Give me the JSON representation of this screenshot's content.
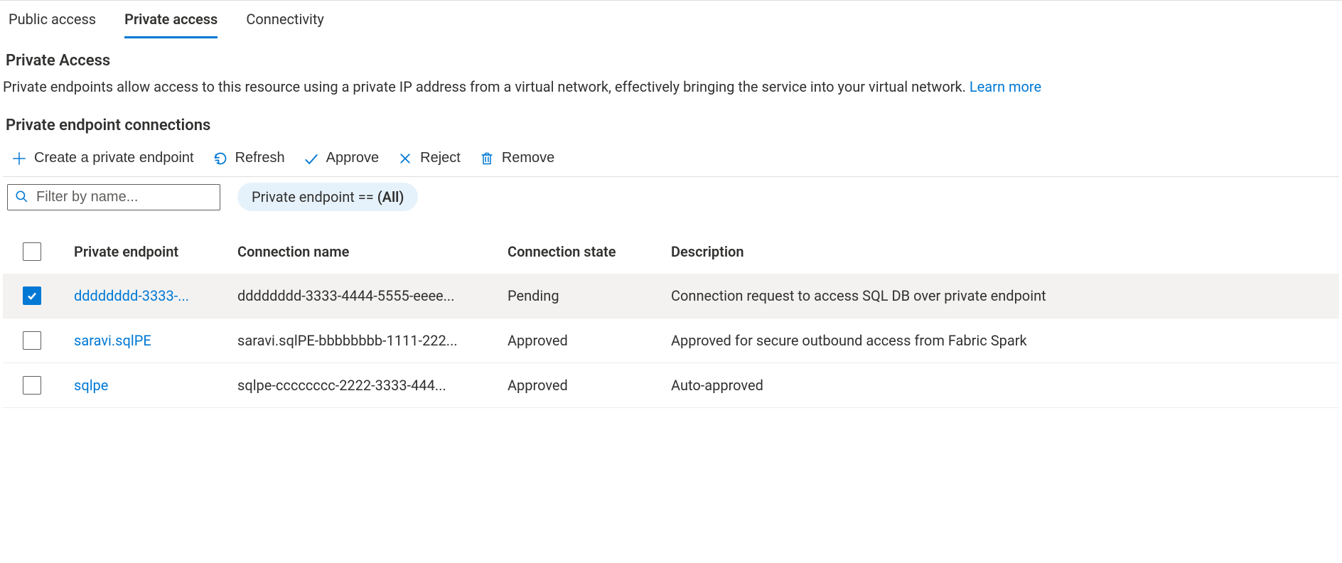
{
  "tabs": [
    {
      "label": "Public access",
      "active": false
    },
    {
      "label": "Private access",
      "active": true
    },
    {
      "label": "Connectivity",
      "active": false
    }
  ],
  "section": {
    "title": "Private Access",
    "description": "Private endpoints allow access to this resource using a private IP address from a virtual network, effectively bringing the service into your virtual network. ",
    "learn_more": "Learn more"
  },
  "connections": {
    "title": "Private endpoint connections"
  },
  "toolbar": {
    "create": "Create a private endpoint",
    "refresh": "Refresh",
    "approve": "Approve",
    "reject": "Reject",
    "remove": "Remove"
  },
  "filter": {
    "search_placeholder": "Filter by name...",
    "pill_prefix": "Private endpoint == ",
    "pill_value": "(All)"
  },
  "table": {
    "headers": {
      "endpoint": "Private endpoint",
      "connection": "Connection name",
      "state": "Connection state",
      "description": "Description"
    },
    "rows": [
      {
        "selected": true,
        "endpoint": "dddddddd-3333-...",
        "connection": "dddddddd-3333-4444-5555-eeee...",
        "state": "Pending",
        "description": "Connection request to access SQL DB over private endpoint"
      },
      {
        "selected": false,
        "endpoint": "saravi.sqlPE",
        "connection": "saravi.sqlPE-bbbbbbbb-1111-222...",
        "state": "Approved",
        "description": "Approved for secure outbound access from Fabric Spark"
      },
      {
        "selected": false,
        "endpoint": "sqlpe",
        "connection": "sqlpe-cccccccc-2222-3333-444...",
        "state": "Approved",
        "description": "Auto-approved"
      }
    ]
  }
}
